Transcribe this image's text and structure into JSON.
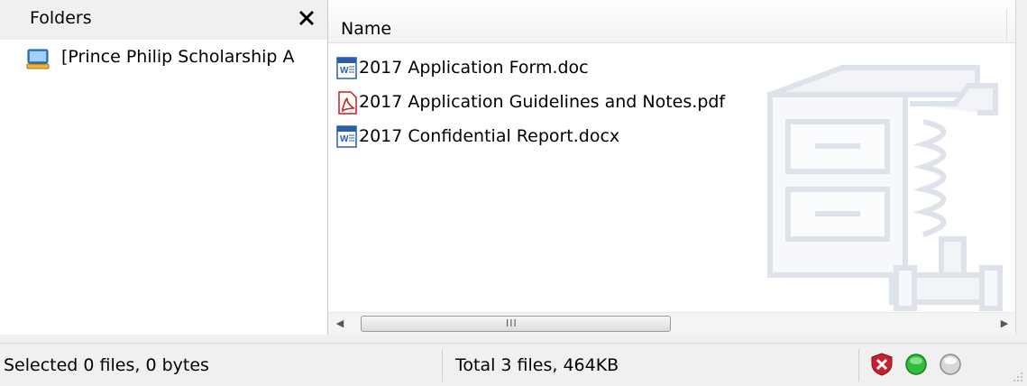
{
  "folders_pane": {
    "title": "Folders",
    "close_glyph": "✕",
    "tree_item_label": "[Prince Philip Scholarship A",
    "tree_item_icon": "computer-icon"
  },
  "file_list": {
    "column_header": "Name",
    "files": [
      {
        "name": "2017 Application Form.doc",
        "icon": "word-document-icon"
      },
      {
        "name": "2017 Application Guidelines and Notes.pdf",
        "icon": "pdf-document-icon"
      },
      {
        "name": "2017 Confidential Report.docx",
        "icon": "word-document-icon"
      }
    ],
    "watermark": "winzip-vise-logo",
    "scrollbar": {
      "left_arrow": "◀",
      "right_arrow": "▶",
      "grip": "III"
    }
  },
  "status_bar": {
    "selected": "Selected 0 files, 0 bytes",
    "total": "Total 3 files, 464KB",
    "indicators": [
      "security-shield-icon",
      "green-status-icon",
      "gray-status-icon"
    ]
  },
  "colors": {
    "word_blue": "#2b5eaa",
    "pdf_red": "#c91f1f",
    "green_status": "#2fbf3a",
    "shield_red": "#c9202f"
  }
}
